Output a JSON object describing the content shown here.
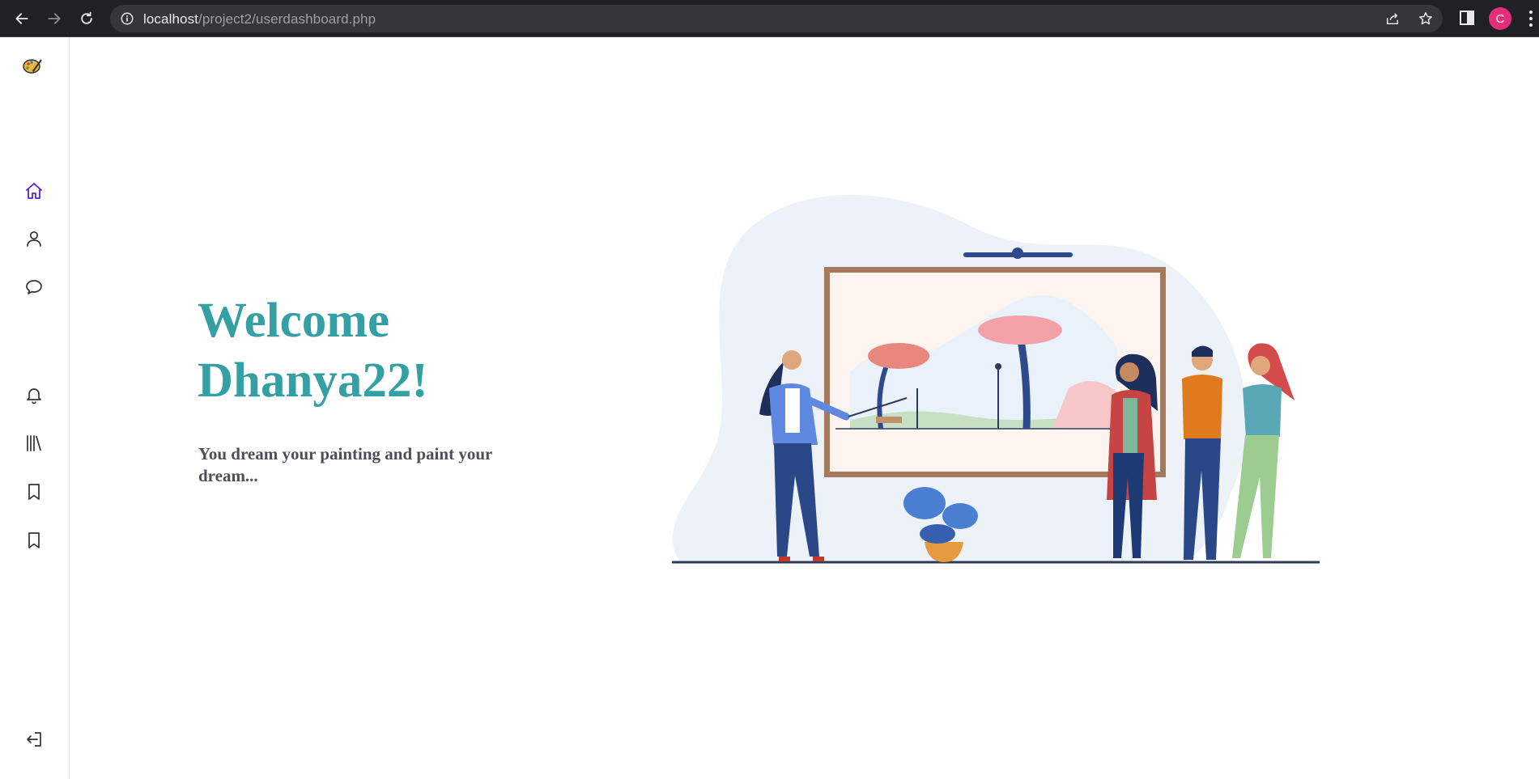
{
  "browser": {
    "url_host": "localhost",
    "url_path": "/project2/userdashboard.php",
    "profile_initial": "C",
    "profile_color": "#e52d7a"
  },
  "sidebar": {
    "items": [
      {
        "name": "home",
        "icon": "home-icon",
        "active": true
      },
      {
        "name": "profile",
        "icon": "user-icon"
      },
      {
        "name": "messages",
        "icon": "chat-bubble-icon"
      },
      {
        "name": "notifications",
        "icon": "bell-icon"
      },
      {
        "name": "library",
        "icon": "library-icon"
      },
      {
        "name": "bookmarks",
        "icon": "bookmark-icon"
      },
      {
        "name": "saved",
        "icon": "bookmark-icon"
      },
      {
        "name": "logout",
        "icon": "logout-icon"
      }
    ],
    "active_color": "#5b21d6"
  },
  "main": {
    "welcome_line1": "Welcome",
    "welcome_line2": "Dhanya22!",
    "tagline": "You dream your painting and paint your dream...",
    "heading_color": "#35a0a3"
  }
}
